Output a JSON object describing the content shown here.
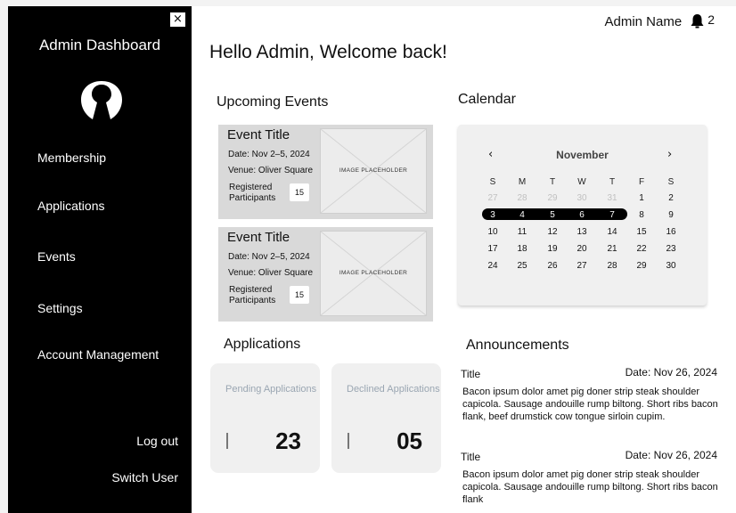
{
  "sidebar": {
    "close_label": "×",
    "title": "Admin Dashboard",
    "nav": [
      "Membership",
      "Applications",
      "Events",
      "Settings",
      "Account Management"
    ],
    "logout_label": "Log out",
    "switch_user_label": "Switch User"
  },
  "header": {
    "admin_name": "Admin Name",
    "notification_count": "2",
    "greeting": "Hello Admin, Welcome back!"
  },
  "events": {
    "section_title": "Upcoming Events",
    "items": [
      {
        "title": "Event Title",
        "date": "Date: Nov 2–5, 2024",
        "venue": "Venue: Oliver Square",
        "registered_label": "Registered Participants",
        "registered_count": "15",
        "image_label": "IMAGE PLACEHOLDER"
      },
      {
        "title": "Event Title",
        "date": "Date: Nov 2–5, 2024",
        "venue": "Venue: Oliver Square",
        "registered_label": "Registered Participants",
        "registered_count": "15",
        "image_label": "IMAGE PLACEHOLDER"
      }
    ]
  },
  "calendar": {
    "section_title": "Calendar",
    "prev_label": "‹",
    "next_label": "›",
    "month": "November",
    "weekdays": [
      "S",
      "M",
      "T",
      "W",
      "T",
      "F",
      "S"
    ],
    "weeks": [
      [
        "27",
        "28",
        "29",
        "30",
        "31",
        "1",
        "2"
      ],
      [
        "3",
        "4",
        "5",
        "6",
        "7",
        "8",
        "9"
      ],
      [
        "10",
        "11",
        "12",
        "13",
        "14",
        "15",
        "16"
      ],
      [
        "17",
        "18",
        "19",
        "20",
        "21",
        "22",
        "23"
      ],
      [
        "24",
        "25",
        "26",
        "27",
        "28",
        "29",
        "30"
      ]
    ],
    "muted_in_first_week": 5,
    "highlighted_week_index": 1,
    "highlighted_days_count": 5
  },
  "applications": {
    "section_title": "Applications",
    "pending_label": "Pending Applications",
    "pending_count": "23",
    "declined_label": "Declined Applications",
    "declined_count": "05"
  },
  "announcements": {
    "section_title": "Announcements",
    "items": [
      {
        "title": "Title",
        "date": "Date: Nov 26, 2024",
        "body": "Bacon ipsum dolor amet pig doner strip steak shoulder capicola. Sausage andouille rump biltong. Short ribs bacon flank, beef drumstick cow tongue sirloin cupim."
      },
      {
        "title": "Title",
        "date": "Date: Nov 26, 2024",
        "body": "Bacon ipsum dolor amet pig doner strip steak shoulder capicola. Sausage andouille rump biltong. Short ribs bacon flank"
      }
    ]
  },
  "colors": {
    "sidebar_bg": "#000000",
    "card_bg": "#d9d9d9",
    "panel_bg": "#f0f0f0",
    "muted_label": "#9aa6b2"
  }
}
